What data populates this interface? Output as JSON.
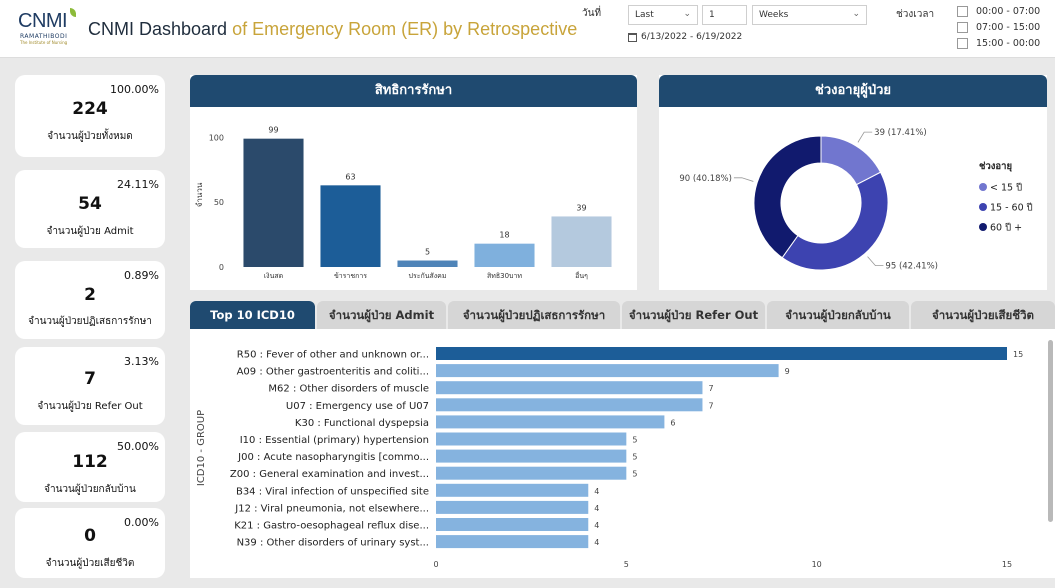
{
  "header": {
    "logo_main": "CNMI",
    "logo_sub": "RAMATHIBODI",
    "logo_tag": "The Institute of Nursing",
    "title_part1": "CNMI Dashboard",
    "title_part2": "of Emergency Room (ER) by Retrospective"
  },
  "filters": {
    "date_label": "วันที่",
    "relative_option": "Last",
    "relative_number": "1",
    "period_unit": "Weeks",
    "date_range": "6/13/2022 - 6/19/2022",
    "time_label": "ช่วงเวลา",
    "time_slots": [
      "00:00 - 07:00",
      "07:00 - 15:00",
      "15:00 - 00:00"
    ]
  },
  "kpis": [
    {
      "percent": "100.00%",
      "value": "224",
      "label": "จำนวนผู้ป่วยทั้งหมด"
    },
    {
      "percent": "24.11%",
      "value": "54",
      "label": "จำนวนผู้ป่วย Admit"
    },
    {
      "percent": "0.89%",
      "value": "2",
      "label": "จำนวนผู้ป่วยปฏิเสธการรักษา"
    },
    {
      "percent": "3.13%",
      "value": "7",
      "label": "จำนวนผู้ป่วย Refer Out"
    },
    {
      "percent": "50.00%",
      "value": "112",
      "label": "จำนวนผู้ป่วยกลับบ้าน"
    },
    {
      "percent": "0.00%",
      "value": "0",
      "label": "จำนวนผู้ป่วยเสียชีวิต"
    }
  ],
  "rights_panel": {
    "title": "สิทธิการรักษา"
  },
  "age_panel": {
    "title": "ช่วงอายุผู้ป่วย"
  },
  "tabs": [
    {
      "label": "Top 10 ICD10",
      "active": true
    },
    {
      "label": "จำนวนผู้ป่วย Admit",
      "active": false
    },
    {
      "label": "จำนวนผู้ป่วยปฏิเสธการรักษา",
      "active": false
    },
    {
      "label": "จำนวนผู้ป่วย Refer Out",
      "active": false
    },
    {
      "label": "จำนวนผู้ป่วยกลับบ้าน",
      "active": false
    },
    {
      "label": "จำนวนผู้ป่วยเสียชีวิต",
      "active": false
    }
  ],
  "chart_data": [
    {
      "type": "bar",
      "title": "สิทธิการรักษา",
      "ylabel": "จำนวน",
      "xlabel": "",
      "categories": [
        "เงินสด",
        "ข้าราชการ",
        "ประกันสังคม",
        "สิทธิ30บาท",
        "อื่นๆ"
      ],
      "values": [
        99,
        63,
        5,
        18,
        39
      ],
      "yticks": [
        0,
        50,
        100
      ],
      "ylim": [
        0,
        108
      ],
      "colors": [
        "#2b4a6b",
        "#1c5d98",
        "#4f84b8",
        "#7fb0dd",
        "#b4c9de"
      ],
      "grid": false
    },
    {
      "type": "pie",
      "title": "ช่วงอายุผู้ป่วย",
      "legend_title": "ช่วงอายุ",
      "legend_position": "right",
      "categories": [
        "< 15 ปี",
        "15 - 60 ปี",
        "60 ปี +"
      ],
      "values": [
        39,
        95,
        90
      ],
      "data_labels": [
        "39 (17.41%)",
        "95 (42.41%)",
        "90 (40.18%)"
      ],
      "colors": [
        "#7176cf",
        "#3d43b0",
        "#111a6e"
      ]
    },
    {
      "type": "bar",
      "title": "Top 10 ICD10",
      "orientation": "horizontal",
      "ylabel": "ICD10 - GROUP",
      "xlabel": "",
      "categories": [
        "R50 : Fever of other and unknown or...",
        "A09 : Other gastroenteritis and coliti...",
        "M62 : Other disorders of muscle",
        "U07 : Emergency use of U07",
        "K30 : Functional dyspepsia",
        "I10 : Essential (primary) hypertension",
        "J00 : Acute nasopharyngitis [commo...",
        "Z00 : General examination and invest...",
        "B34 : Viral infection of unspecified site",
        "J12 : Viral pneumonia, not elsewhere...",
        "K21 : Gastro-oesophageal reflux dise...",
        "N39 : Other disorders of urinary syst..."
      ],
      "values": [
        15,
        9,
        7,
        7,
        6,
        5,
        5,
        5,
        4,
        4,
        4,
        4
      ],
      "xticks": [
        0,
        5,
        10,
        15
      ],
      "xlim": [
        0,
        15
      ],
      "colors": [
        "#1c5d98",
        "#85b3df"
      ],
      "grid": false
    }
  ]
}
